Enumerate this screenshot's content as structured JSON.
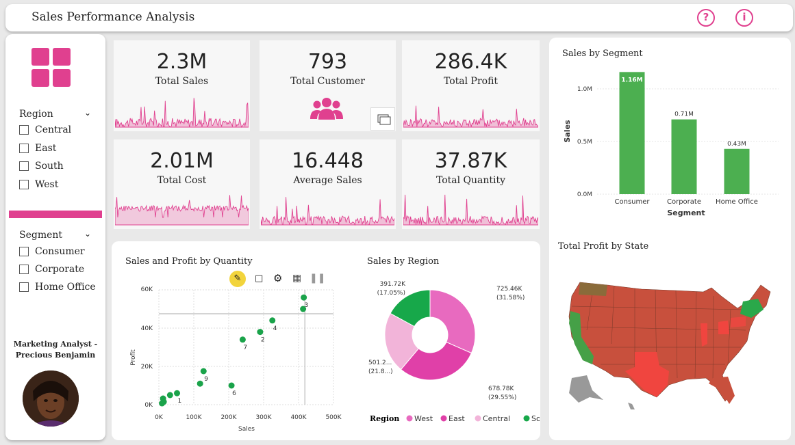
{
  "header": {
    "title": "Sales Performance Analysis",
    "help_icon": "question-icon",
    "info_icon": "info-icon",
    "accent": "#e0408f"
  },
  "sidebar": {
    "region_label": "Region",
    "regions": [
      "Central",
      "East",
      "South",
      "West"
    ],
    "segment_label": "Segment",
    "segments": [
      "Consumer",
      "Corporate",
      "Home Office"
    ],
    "analyst_line1": "Marketing Analyst -",
    "analyst_line2": "Precious Benjamin"
  },
  "kpis": {
    "total_sales": {
      "value": "2.3M",
      "label": "Total Sales"
    },
    "total_customer": {
      "value": "793",
      "label": "Total Customer"
    },
    "total_profit": {
      "value": "286.4K",
      "label": "Total Profit"
    },
    "total_cost": {
      "value": "2.01M",
      "label": "Total Cost"
    },
    "average_sales": {
      "value": "16.448",
      "label": "Average Sales"
    },
    "total_quantity": {
      "value": "37.87K",
      "label": "Total Quantity"
    }
  },
  "scatter": {
    "title": "Sales and Profit by Quantity",
    "xlabel": "Sales",
    "ylabel": "Profit",
    "xticks": [
      "0K",
      "100K",
      "200K",
      "300K",
      "400K",
      "500K"
    ],
    "yticks": [
      "0K",
      "20K",
      "40K",
      "60K"
    ]
  },
  "donut": {
    "title": "Sales by Region",
    "legend_title": "Region",
    "labels": {
      "west": "725.46K",
      "west_pct": "(31.58%)",
      "east": "678.78K",
      "east_pct": "(29.55%)",
      "central": "501.2...",
      "central_pct": "(21.8...)",
      "south": "391.72K",
      "south_pct": "(17.05%)"
    }
  },
  "segment_chart": {
    "title": "Sales by Segment",
    "ylabel": "Sales",
    "xlabel": "Segment",
    "yticks": [
      "0.0M",
      "0.5M",
      "1.0M"
    ]
  },
  "map": {
    "title": "Total Profit by State"
  },
  "chart_data": [
    {
      "type": "scatter",
      "title": "Sales and Profit by Quantity",
      "xlabel": "Sales",
      "ylabel": "Profit",
      "xlim": [
        0,
        500000
      ],
      "ylim": [
        0,
        60000
      ],
      "points": [
        {
          "label": "3",
          "x": 415000,
          "y": 56000
        },
        {
          "label": "",
          "x": 413000,
          "y": 50000
        },
        {
          "label": "4",
          "x": 325000,
          "y": 44000
        },
        {
          "label": "2",
          "x": 290000,
          "y": 38000
        },
        {
          "label": "7",
          "x": 240000,
          "y": 34000
        },
        {
          "label": "9",
          "x": 128000,
          "y": 17500
        },
        {
          "label": "",
          "x": 118000,
          "y": 11000
        },
        {
          "label": "6",
          "x": 208000,
          "y": 10000
        },
        {
          "label": "1",
          "x": 52000,
          "y": 6000
        },
        {
          "label": "",
          "x": 32000,
          "y": 5000
        },
        {
          "label": "",
          "x": 12000,
          "y": 3200
        },
        {
          "label": "",
          "x": 14000,
          "y": 1500
        },
        {
          "label": "",
          "x": 9000,
          "y": 700
        }
      ],
      "color": "#1aa34a"
    },
    {
      "type": "pie",
      "title": "Sales by Region",
      "categories": [
        "West",
        "East",
        "Central",
        "South"
      ],
      "values": [
        725460,
        678780,
        501200,
        391720
      ],
      "percent": [
        31.58,
        29.55,
        21.8,
        17.05
      ],
      "colors": [
        "#e86abf",
        "#e040a8",
        "#f2b4d9",
        "#17a84a"
      ]
    },
    {
      "type": "bar",
      "title": "Sales by Segment",
      "categories": [
        "Consumer",
        "Corporate",
        "Home Office"
      ],
      "values": [
        1.16,
        0.71,
        0.43
      ],
      "value_labels": [
        "1.16M",
        "0.71M",
        "0.43M"
      ],
      "xlabel": "Segment",
      "ylabel": "Sales",
      "ylim": [
        0,
        1.2
      ],
      "color": "#4caf50"
    }
  ]
}
